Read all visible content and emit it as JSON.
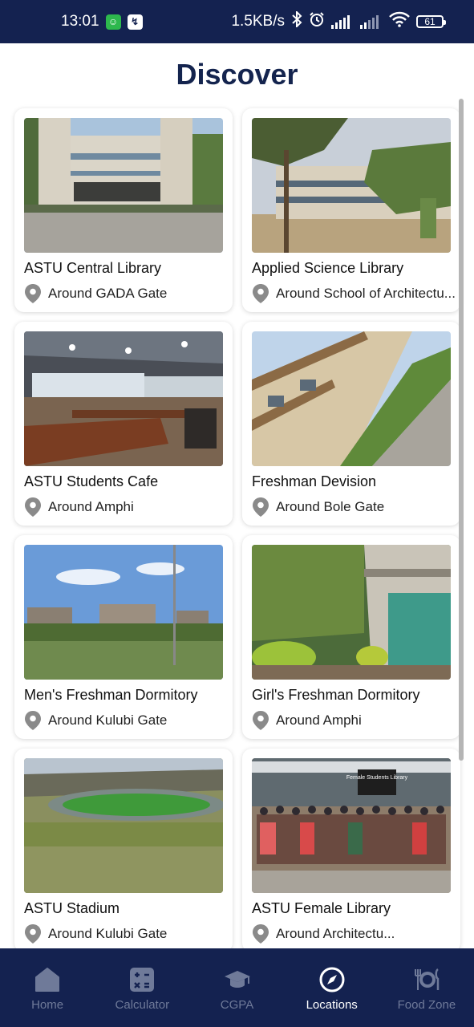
{
  "status_bar": {
    "time": "13:01",
    "net_speed": "1.5KB/s",
    "battery": "61"
  },
  "header": {
    "title": "Discover"
  },
  "places": [
    {
      "title": "ASTU Central Library",
      "location": "Around GADA Gate"
    },
    {
      "title": "Applied Science Library",
      "location": "Around School of Architectu..."
    },
    {
      "title": "ASTU Students Cafe",
      "location": "Around Amphi"
    },
    {
      "title": "Freshman Devision",
      "location": "Around Bole Gate"
    },
    {
      "title": "Men's Freshman Dormitory",
      "location": "Around Kulubi Gate"
    },
    {
      "title": "Girl's Freshman Dormitory",
      "location": "Around Amphi"
    },
    {
      "title": "ASTU Stadium",
      "location": "Around Kulubi Gate"
    },
    {
      "title": "ASTU Female Library",
      "location": "Around Architectu..."
    }
  ],
  "photo_sign": "Female Students Library",
  "nav": {
    "items": [
      {
        "label": "Home",
        "icon": "home-icon",
        "active": false
      },
      {
        "label": "Calculator",
        "icon": "calculator-icon",
        "active": false
      },
      {
        "label": "CGPA",
        "icon": "graduation-cap-icon",
        "active": false
      },
      {
        "label": "Locations",
        "icon": "compass-icon",
        "active": true
      },
      {
        "label": "Food Zone",
        "icon": "food-icon",
        "active": false
      }
    ]
  },
  "colors": {
    "primary": "#142250",
    "title": "#14244e",
    "nav_inactive": "#6f7a99",
    "nav_active": "#ffffff"
  }
}
